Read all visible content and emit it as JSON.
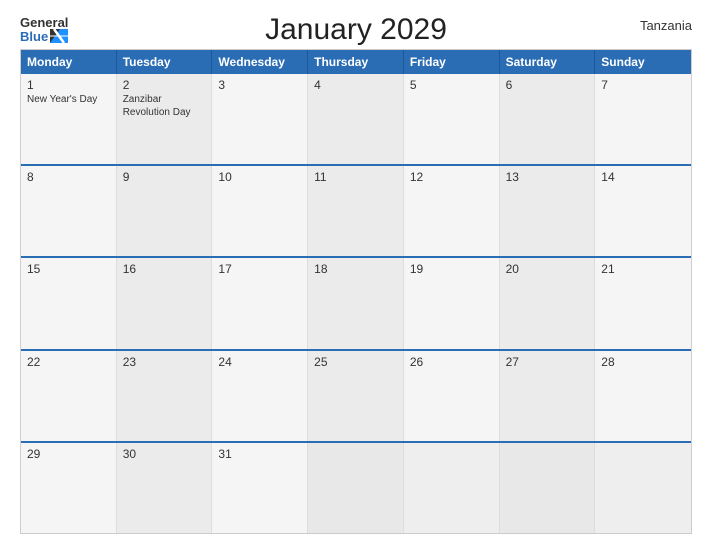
{
  "header": {
    "logo_general": "General",
    "logo_blue": "Blue",
    "title": "January 2029",
    "country": "Tanzania"
  },
  "calendar": {
    "days_of_week": [
      "Monday",
      "Tuesday",
      "Wednesday",
      "Thursday",
      "Friday",
      "Saturday",
      "Sunday"
    ],
    "weeks": [
      [
        {
          "day": "1",
          "holiday": "New Year's Day"
        },
        {
          "day": "2",
          "holiday": "Zanzibar Revolution Day"
        },
        {
          "day": "3",
          "holiday": ""
        },
        {
          "day": "4",
          "holiday": ""
        },
        {
          "day": "5",
          "holiday": ""
        },
        {
          "day": "6",
          "holiday": ""
        },
        {
          "day": "7",
          "holiday": ""
        }
      ],
      [
        {
          "day": "8",
          "holiday": ""
        },
        {
          "day": "9",
          "holiday": ""
        },
        {
          "day": "10",
          "holiday": ""
        },
        {
          "day": "11",
          "holiday": ""
        },
        {
          "day": "12",
          "holiday": ""
        },
        {
          "day": "13",
          "holiday": ""
        },
        {
          "day": "14",
          "holiday": ""
        }
      ],
      [
        {
          "day": "15",
          "holiday": ""
        },
        {
          "day": "16",
          "holiday": ""
        },
        {
          "day": "17",
          "holiday": ""
        },
        {
          "day": "18",
          "holiday": ""
        },
        {
          "day": "19",
          "holiday": ""
        },
        {
          "day": "20",
          "holiday": ""
        },
        {
          "day": "21",
          "holiday": ""
        }
      ],
      [
        {
          "day": "22",
          "holiday": ""
        },
        {
          "day": "23",
          "holiday": ""
        },
        {
          "day": "24",
          "holiday": ""
        },
        {
          "day": "25",
          "holiday": ""
        },
        {
          "day": "26",
          "holiday": ""
        },
        {
          "day": "27",
          "holiday": ""
        },
        {
          "day": "28",
          "holiday": ""
        }
      ],
      [
        {
          "day": "29",
          "holiday": ""
        },
        {
          "day": "30",
          "holiday": ""
        },
        {
          "day": "31",
          "holiday": ""
        },
        {
          "day": "",
          "holiday": ""
        },
        {
          "day": "",
          "holiday": ""
        },
        {
          "day": "",
          "holiday": ""
        },
        {
          "day": "",
          "holiday": ""
        }
      ]
    ]
  }
}
